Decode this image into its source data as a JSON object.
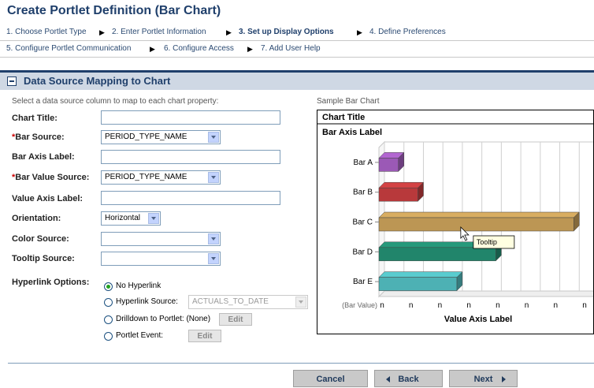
{
  "page": {
    "title": "Create Portlet Definition (Bar Chart)"
  },
  "steps": {
    "row1": [
      {
        "label": "1. Choose Portlet Type"
      },
      {
        "label": "2. Enter Portlet Information"
      },
      {
        "label": "3. Set up Display Options"
      },
      {
        "label": "4. Define Preferences"
      }
    ],
    "row2": [
      {
        "label": "5. Configure Portlet Communication"
      },
      {
        "label": "6. Configure Access"
      },
      {
        "label": "7. Add User Help"
      }
    ],
    "separator": "▶"
  },
  "section": {
    "title": "Data Source Mapping to Chart",
    "instruction": "Select a data source column to map to each chart property:"
  },
  "form": {
    "chart_title": {
      "label": "Chart Title:",
      "value": ""
    },
    "bar_source": {
      "required_mark": "*",
      "label": "Bar Source:",
      "value": "PERIOD_TYPE_NAME"
    },
    "bar_axis_label": {
      "label": "Bar Axis Label:",
      "value": ""
    },
    "bar_value_source": {
      "required_mark": "*",
      "label": "Bar Value Source:",
      "value": "PERIOD_TYPE_NAME"
    },
    "value_axis_label": {
      "label": "Value Axis Label:",
      "value": ""
    },
    "orientation": {
      "label": "Orientation:",
      "value": "Horizontal"
    },
    "color_source": {
      "label": "Color Source:",
      "value": ""
    },
    "tooltip_source": {
      "label": "Tooltip Source:",
      "value": ""
    },
    "hyperlink": {
      "label": "Hyperlink Options:",
      "options": [
        {
          "label": "No Hyperlink",
          "selected": true
        },
        {
          "label": "Hyperlink Source:",
          "selected": false,
          "select_value": "ACTUALS_TO_DATE"
        },
        {
          "label": "Drilldown to Portlet: (None)",
          "selected": false,
          "button": "Edit"
        },
        {
          "label": "Portlet Event:",
          "selected": false,
          "button": "Edit"
        }
      ]
    }
  },
  "sample": {
    "caption": "Sample Bar Chart"
  },
  "chart_data": {
    "type": "bar",
    "orientation": "horizontal",
    "title": "Chart Title",
    "bar_axis_label": "Bar Axis Label",
    "value_axis_label": "Value Axis Label",
    "value_axis_prefix": "(Bar Value)",
    "categories": [
      "Bar A",
      "Bar B",
      "Bar C",
      "Bar D",
      "Bar E"
    ],
    "values": [
      1,
      2,
      10,
      6,
      4
    ],
    "xlim": [
      0,
      11
    ],
    "ticks": [
      "n",
      "n",
      "n",
      "n",
      "n",
      "n",
      "n",
      "n"
    ],
    "colors": [
      "#9b59b6",
      "#b8393b",
      "#bc9654",
      "#21856b",
      "#4db1b4"
    ],
    "grid": true,
    "tooltip": "Tooltip",
    "tooltip_target": "Bar C"
  },
  "buttons": {
    "cancel": "Cancel",
    "back": "Back",
    "next": "Next"
  }
}
